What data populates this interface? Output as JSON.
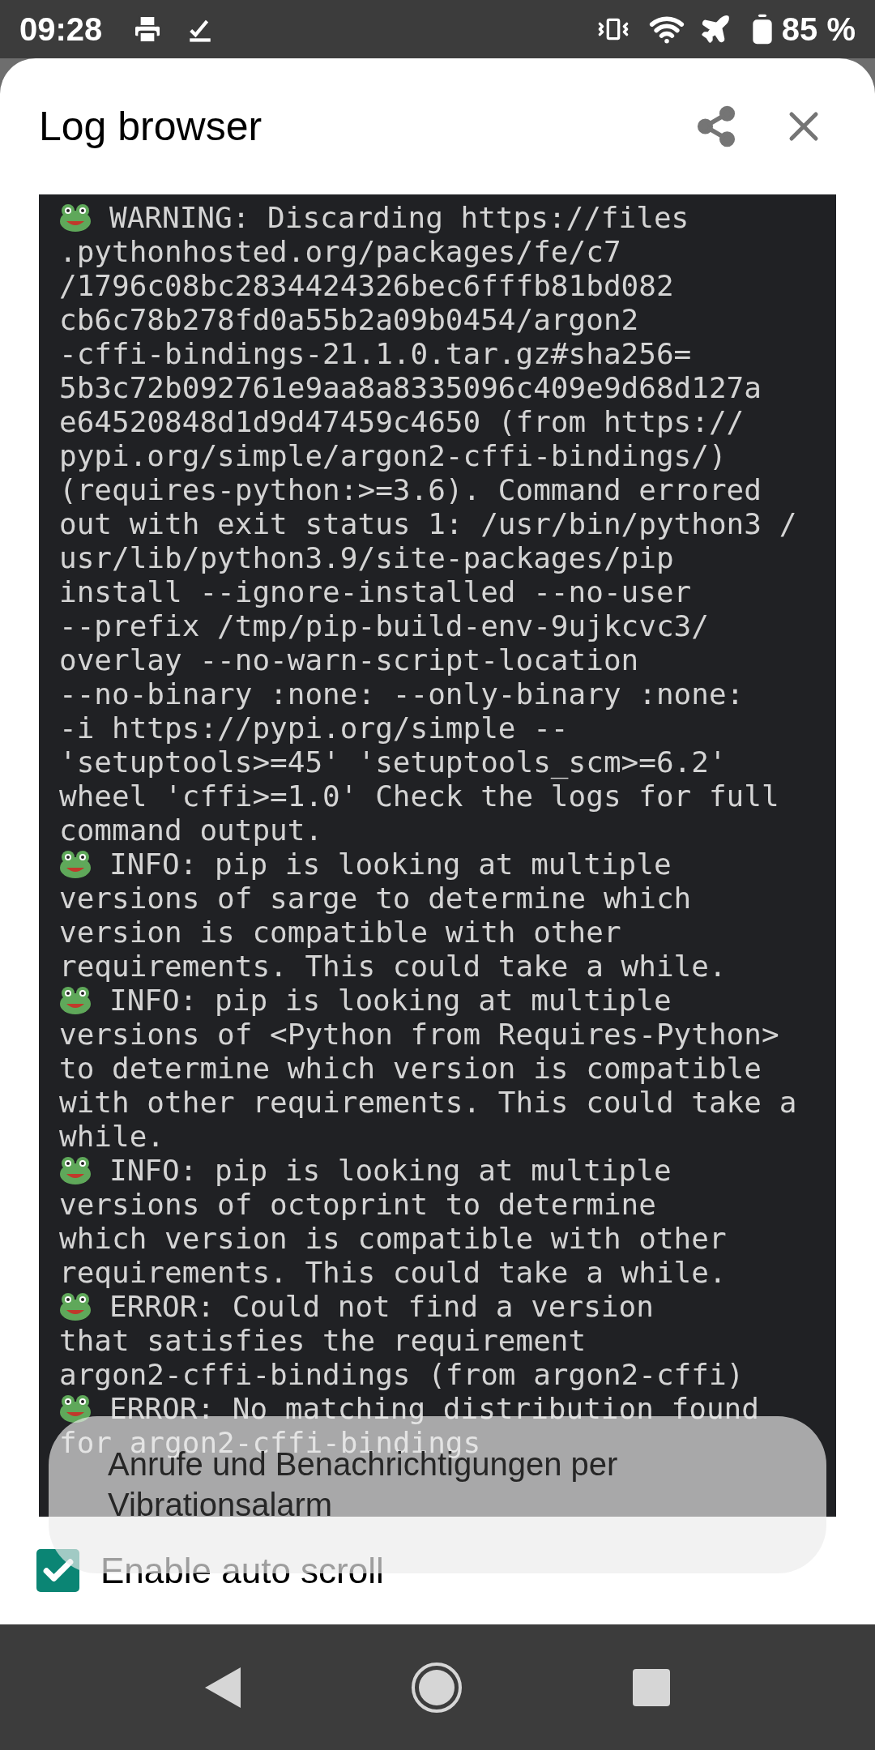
{
  "status_bar": {
    "time": "09:28",
    "battery": "85 %"
  },
  "title": "Log browser",
  "log": [
    {
      "lines": [
        "WARNING: Discarding https://files",
        ".pythonhosted.org/packages/fe/c7",
        "/1796c08bc2834424326bec6fffb81bd082",
        "cb6c78b278fd0a55b2a09b0454/argon2",
        "-cffi-bindings-21.1.0.tar.gz#sha256=",
        "5b3c72b092761e9aa8a8335096c409e9d68d127a",
        "e64520848d1d9d47459c4650 (from https://",
        "pypi.org/simple/argon2-cffi-bindings/)",
        "(requires-python:>=3.6). Command errored",
        "out with exit status 1: /usr/bin/python3 /",
        "usr/lib/python3.9/site-packages/pip",
        "install --ignore-installed --no-user",
        "--prefix /tmp/pip-build-env-9ujkcvc3/",
        "overlay --no-warn-script-location",
        "--no-binary :none: --only-binary :none:",
        "-i https://pypi.org/simple --",
        "'setuptools>=45' 'setuptools_scm>=6.2'",
        "wheel 'cffi>=1.0' Check the logs for full",
        "command output."
      ]
    },
    {
      "lines": [
        "INFO: pip is looking at multiple",
        "versions of sarge to determine which",
        "version is compatible with other",
        "requirements. This could take a while."
      ]
    },
    {
      "lines": [
        "INFO: pip is looking at multiple",
        "versions of <Python from Requires-Python>",
        "to determine which version is compatible",
        "with other requirements. This could take a",
        "while."
      ]
    },
    {
      "lines": [
        "INFO: pip is looking at multiple",
        "versions of octoprint to determine",
        "which version is compatible with other",
        "requirements. This could take a while."
      ]
    },
    {
      "lines": [
        "ERROR: Could not find a version",
        "that satisfies the requirement",
        "argon2-cffi-bindings (from argon2-cffi)"
      ]
    },
    {
      "lines": [
        "ERROR: No matching distribution found",
        "for argon2-cffi-bindings"
      ]
    }
  ],
  "auto_scroll": {
    "label": "Enable auto scroll",
    "checked": true
  },
  "toast": {
    "lines": [
      "Anrufe und Benachrichtigungen per",
      "Vibrationsalarm"
    ]
  }
}
